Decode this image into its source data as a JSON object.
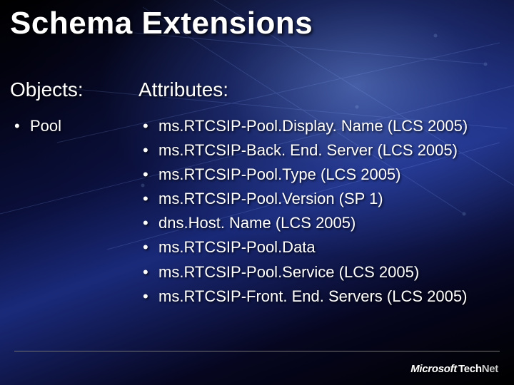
{
  "title": "Schema Extensions",
  "left": {
    "heading": "Objects:",
    "items": [
      "Pool"
    ]
  },
  "right": {
    "heading": "Attributes:",
    "items": [
      "ms.RTCSIP-Pool.Display. Name (LCS 2005)",
      "ms.RTCSIP-Back. End. Server (LCS 2005)",
      "ms.RTCSIP-Pool.Type (LCS 2005)",
      "ms.RTCSIP-Pool.Version (SP 1)",
      "dns.Host. Name (LCS 2005)",
      "ms.RTCSIP-Pool.Data",
      "ms.RTCSIP-Pool.Service (LCS 2005)",
      "ms.RTCSIP-Front. End. Servers (LCS 2005)"
    ]
  },
  "logo": {
    "ms": "Microsoft",
    "tech": "Tech",
    "net": "Net"
  }
}
